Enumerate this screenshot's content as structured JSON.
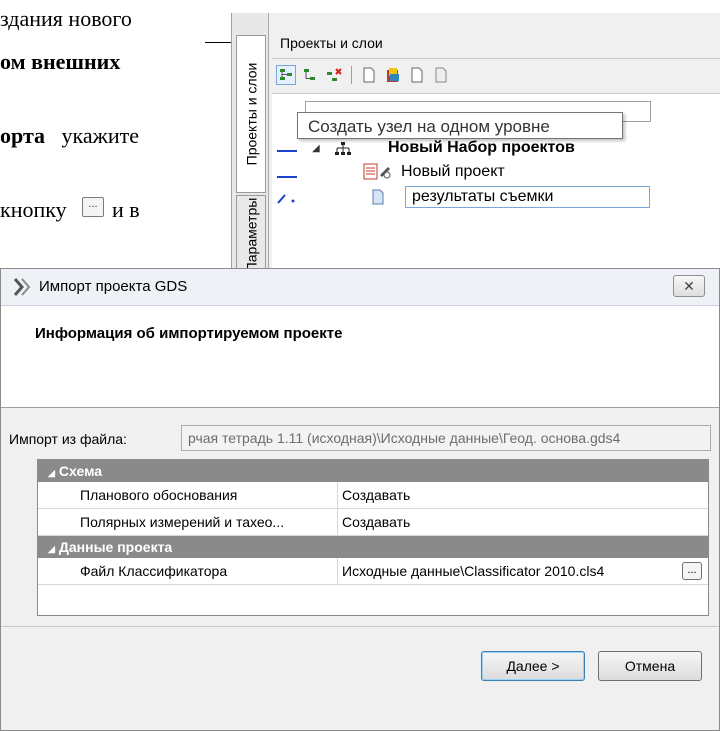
{
  "document": {
    "line1": "здания нового",
    "line2": "ом   внешних",
    "line3_bold": "орта",
    "line3_rest": "укажите",
    "line4_left": "кнопку",
    "line4_right": "и в",
    "button_glyph": "..."
  },
  "panel": {
    "tabs": [
      "Проекты и слои",
      "Параметры"
    ],
    "title": "Проекты и слои",
    "tooltip": "Создать узел на одном уровне",
    "tree": {
      "root": "Новый Набор проектов",
      "project": "Новый проект",
      "editing": "результаты съемки"
    }
  },
  "dialog": {
    "title": "Импорт проекта GDS",
    "close_glyph": "✕",
    "heading": "Информация об импортируемом проекте",
    "source_label": "Импорт из файла:",
    "source_value": "рчая тетрадь 1.11 (исходная)\\Исходные данные\\Геод. основа.gds4",
    "groups": [
      {
        "name": "Схема",
        "rows": [
          {
            "name": "Планового обоснования",
            "value": "Создавать"
          },
          {
            "name": "Полярных измерений и тахео...",
            "value": "Создавать"
          }
        ]
      },
      {
        "name": "Данные проекта",
        "rows": [
          {
            "name": "Файл Классификатора",
            "value": "Исходные данные\\Classificator 2010.cls4"
          }
        ]
      }
    ],
    "ellipsis": "...",
    "next_label": "Далее >",
    "cancel_label": "Отмена"
  }
}
